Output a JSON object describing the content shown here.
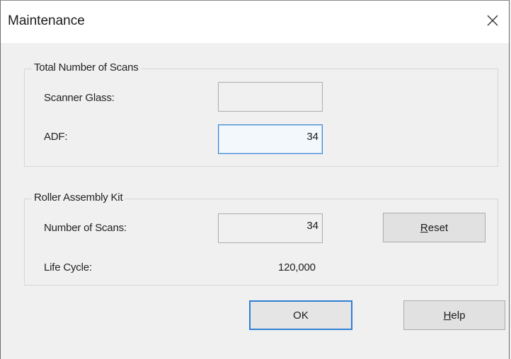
{
  "window": {
    "title": "Maintenance",
    "close_icon": "close-icon"
  },
  "total_scans": {
    "label": "Total Number of Scans",
    "scanner_glass_label": "Scanner Glass:",
    "scanner_glass_value": "",
    "adf_label": "ADF:",
    "adf_value": "34"
  },
  "roller_kit": {
    "label": "Roller Assembly Kit",
    "scans_label": "Number of Scans:",
    "scans_value": "34",
    "reset_mnemonic": "R",
    "reset_rest": "eset",
    "life_cycle_label": "Life Cycle:",
    "life_cycle_value": "120,000"
  },
  "buttons": {
    "ok_label": "OK",
    "help_mnemonic": "H",
    "help_rest": "elp"
  }
}
